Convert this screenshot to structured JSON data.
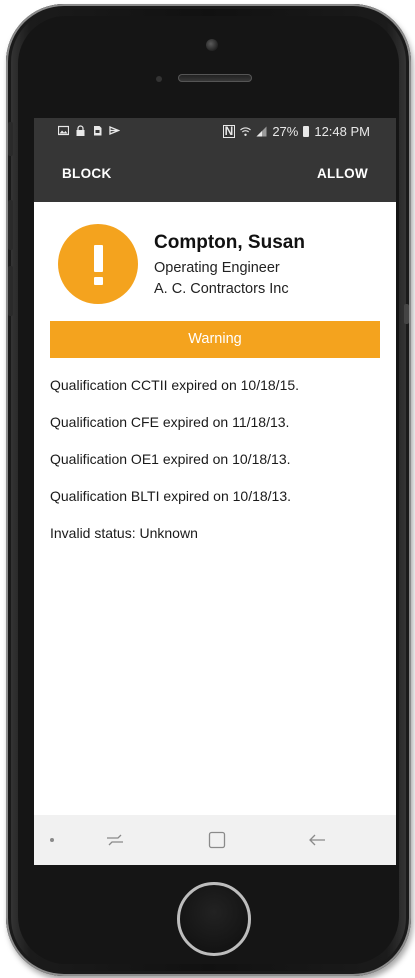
{
  "status_bar": {
    "left_icons": [
      "gallery-icon",
      "lock-icon",
      "sd-card-icon",
      "cast-icon"
    ],
    "nfc_label": "N",
    "battery_percent": "27%",
    "time": "12:48 PM"
  },
  "action_bar": {
    "block_label": "BLOCK",
    "allow_label": "ALLOW"
  },
  "person": {
    "name": "Compton, Susan",
    "role": "Operating Engineer",
    "company": "A. C. Contractors Inc",
    "alert_icon": "exclamation-icon"
  },
  "warning": {
    "label": "Warning",
    "color": "#F4A31E"
  },
  "issues": [
    "Qualification CCTII expired on 10/18/15.",
    "Qualification CFE expired on 11/18/13.",
    "Qualification OE1 expired on 10/18/13.",
    "Qualification BLTI expired on 10/18/13.",
    "Invalid status: Unknown"
  ],
  "nav_bar": {
    "icons": [
      "recent-apps-icon",
      "home-icon",
      "back-icon"
    ]
  },
  "colors": {
    "toolbar": "#363636",
    "accent": "#F4A31E"
  }
}
